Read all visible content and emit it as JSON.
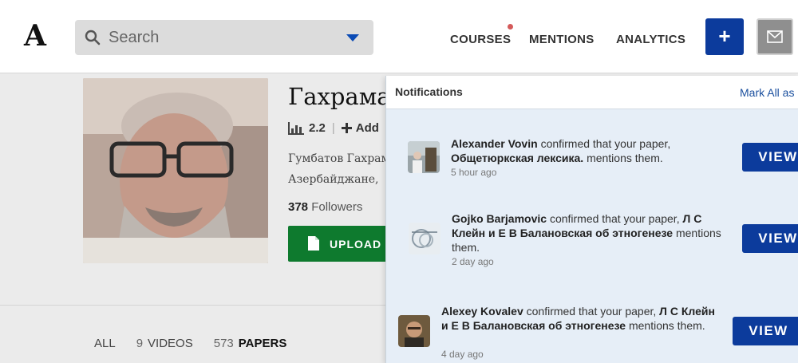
{
  "header": {
    "logo": "A",
    "search_placeholder": "Search",
    "nav": {
      "courses": "COURSES",
      "mentions": "MENTIONS",
      "analytics": "ANALYTICS"
    },
    "plus_label": "+",
    "accent_color": "#0c3b9c"
  },
  "profile": {
    "name": "Гахраман Гумбатов",
    "score": "2.2",
    "add_label": "Add",
    "bio_line1": "Гумбатов Гахраман",
    "bio_line2": "Азербайджане,",
    "followers_count": "378",
    "followers_label": "Followers",
    "upload_label": "UPLOAD",
    "upload_color": "#0e7a2e"
  },
  "tabs": {
    "all": "ALL",
    "videos_count": "9",
    "videos_label": "VIDEOS",
    "papers_count": "573",
    "papers_label": "PAPERS"
  },
  "notifications": {
    "title": "Notifications",
    "mark_all": "Mark All as",
    "view_label": "VIEW",
    "items": [
      {
        "name": "Alexander Vovin",
        "verb": "confirmed that your paper,",
        "paper": "Общетюркская лексика.",
        "tail": "mentions them.",
        "time": "5 hour ago"
      },
      {
        "name": "Gojko Barjamovic",
        "verb": "confirmed that your paper,",
        "paper": "Л С Клейн и Е В Балановская об этногенезе",
        "tail": "mentions them.",
        "time": "2 day ago"
      },
      {
        "name": "Alexey Kovalev",
        "verb": "confirmed that your paper,",
        "paper": "Л С Клейн и Е В Балановская об этногенезе",
        "tail": "mentions them.",
        "time": "4 day ago"
      }
    ]
  }
}
